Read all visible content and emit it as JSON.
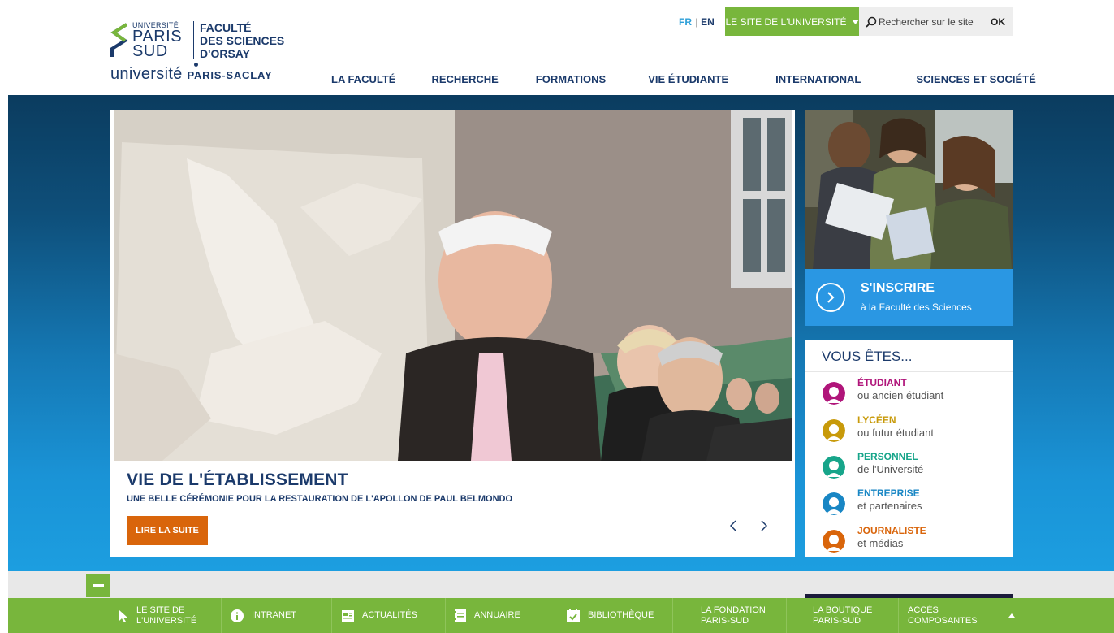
{
  "header": {
    "logo": {
      "universite_small": "UNIVERSITÉ",
      "paris": "PARIS",
      "sud": "SUD",
      "faculte_line1": "FACULTÉ",
      "faculte_line2": "DES SCIENCES",
      "faculte_line3": "D'ORSAY",
      "saclay_word": "université",
      "saclay_rest": "PARIS-SACLAY"
    },
    "lang": {
      "fr": "FR",
      "en": "EN"
    },
    "univ_site_label": "LE SITE DE L'UNIVERSITÉ",
    "search": {
      "placeholder": "Rechercher sur le site",
      "ok": "OK"
    },
    "nav": [
      "LA FACULTÉ",
      "RECHERCHE",
      "FORMATIONS",
      "VIE ÉTUDIANTE",
      "INTERNATIONAL",
      "SCIENCES ET SOCIÉTÉ"
    ]
  },
  "slide": {
    "category": "VIE DE L'ÉTABLISSEMENT",
    "subtitle": "UNE BELLE CÉRÉMONIE POUR LA RESTAURATION DE L'APOLLON DE PAUL BELMONDO",
    "read_more": "LIRE LA SUITE"
  },
  "inscrire": {
    "title": "S'INSCRIRE",
    "subtitle": "à la Faculté des Sciences"
  },
  "vous": {
    "title": "VOUS ÊTES...",
    "items": [
      {
        "label": "ÉTUDIANT",
        "desc": "ou ancien étudiant",
        "color": "#b0157a"
      },
      {
        "label": "LYCÉEN",
        "desc": "ou futur étudiant",
        "color": "#c89a0a"
      },
      {
        "label": "PERSONNEL",
        "desc": "de l'Université",
        "color": "#17a58a"
      },
      {
        "label": "ENTREPRISE",
        "desc": "et partenaires",
        "color": "#1886c4"
      },
      {
        "label": "JOURNALISTE",
        "desc": "et médias",
        "color": "#d9650b"
      }
    ]
  },
  "footer": {
    "items": [
      {
        "line1": "LE SITE DE",
        "line2": "L'UNIVERSITÉ",
        "icon": "cursor-icon"
      },
      {
        "line1": "INTRANET",
        "line2": "",
        "icon": "info-icon"
      },
      {
        "line1": "ACTUALITÉS",
        "line2": "",
        "icon": "newspaper-icon"
      },
      {
        "line1": "ANNUAIRE",
        "line2": "",
        "icon": "addressbook-icon"
      },
      {
        "line1": "BIBLIOTHÈQUE",
        "line2": "",
        "icon": "checkbook-icon"
      },
      {
        "line1": "LA FONDATION",
        "line2": "PARIS-SUD",
        "icon": ""
      },
      {
        "line1": "LA BOUTIQUE",
        "line2": "PARIS-SUD",
        "icon": ""
      },
      {
        "line1": "ACCÈS",
        "line2": "COMPOSANTES",
        "icon": ""
      }
    ]
  },
  "colors": {
    "brand_navy": "#1b3a6b",
    "accent_green": "#78b63c",
    "accent_blue": "#2a97e3",
    "accent_orange": "#d9650b"
  }
}
